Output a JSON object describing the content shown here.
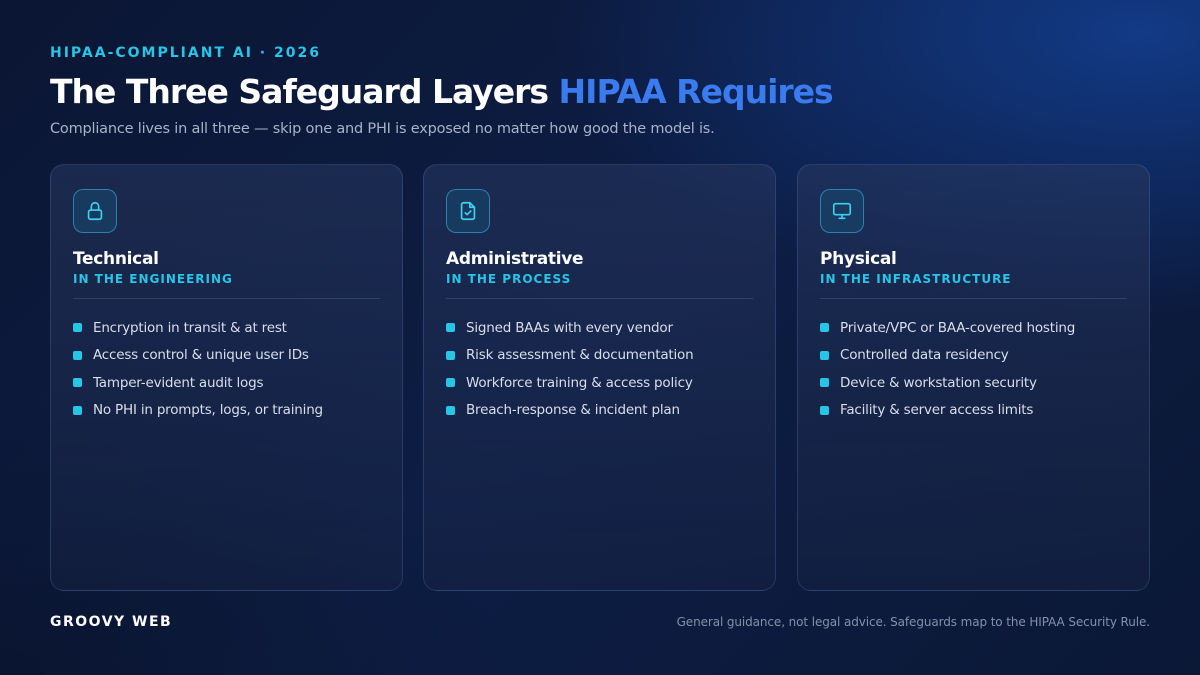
{
  "eyebrow": "HIPAA-COMPLIANT AI · 2026",
  "title": {
    "main": "The Three Safeguard Layers",
    "accent": "HIPAA Requires"
  },
  "subtitle": "Compliance lives in all three — skip one and PHI is exposed no matter how good the model is.",
  "cards": [
    {
      "icon": "lock-icon",
      "title": "Technical",
      "subtitle": "IN THE ENGINEERING",
      "items": [
        "Encryption in transit & at rest",
        "Access control & unique user IDs",
        "Tamper-evident audit logs",
        "No PHI in prompts, logs, or training"
      ]
    },
    {
      "icon": "document-check-icon",
      "title": "Administrative",
      "subtitle": "IN THE PROCESS",
      "items": [
        "Signed BAAs with every vendor",
        "Risk assessment & documentation",
        "Workforce training & access policy",
        "Breach-response & incident plan"
      ]
    },
    {
      "icon": "monitor-icon",
      "title": "Physical",
      "subtitle": "IN THE INFRASTRUCTURE",
      "items": [
        "Private/VPC or BAA-covered hosting",
        "Controlled data residency",
        "Device & workstation security",
        "Facility & server access limits"
      ]
    }
  ],
  "footer": {
    "brand": "GROOVY WEB",
    "note": "General guidance, not legal advice. Safeguards map to the HIPAA Security Rule."
  },
  "colors": {
    "accent_cyan": "#27c5e6",
    "accent_blue": "#3b7bf0",
    "background": "#0d1d44"
  }
}
